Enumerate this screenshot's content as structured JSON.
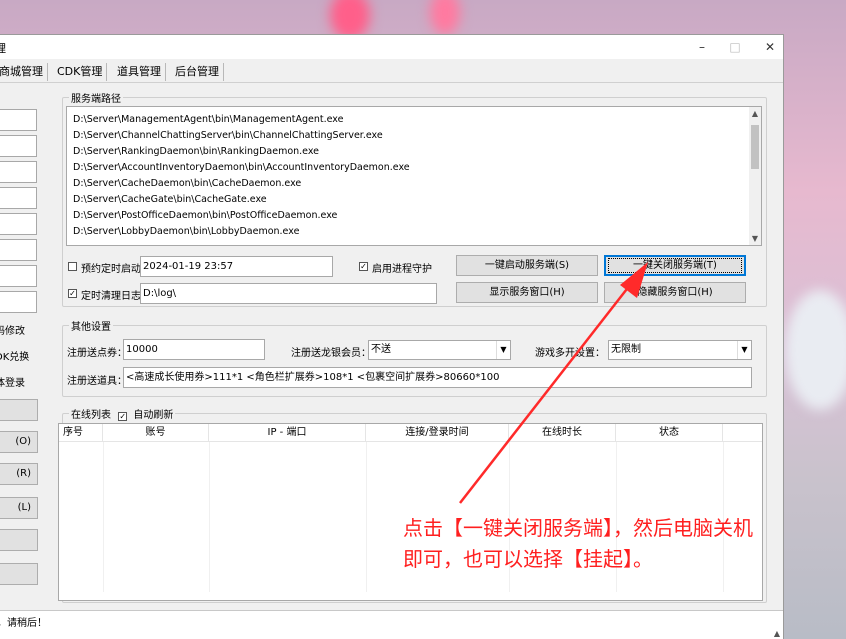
{
  "window": {
    "title": "理",
    "minimize": "–",
    "maximize": "□",
    "close": "✕"
  },
  "tabs": [
    "商城管理",
    "CDK管理",
    "道具管理",
    "后台管理"
  ],
  "left_panel": {
    "labels": [
      "码修改",
      "DK兑换",
      "体登录"
    ],
    "buttons": [
      "",
      "(O)",
      "(R)",
      "(L)",
      "",
      ""
    ]
  },
  "service_paths": {
    "title": "服务端路径",
    "items": [
      "D:\\Server\\ManagementAgent\\bin\\ManagementAgent.exe",
      "D:\\Server\\ChannelChattingServer\\bin\\ChannelChattingServer.exe",
      "D:\\Server\\RankingDaemon\\bin\\RankingDaemon.exe",
      "D:\\Server\\AccountInventoryDaemon\\bin\\AccountInventoryDaemon.exe",
      "D:\\Server\\CacheDaemon\\bin\\CacheDaemon.exe",
      "D:\\Server\\CacheGate\\bin\\CacheGate.exe",
      "D:\\Server\\PostOfficeDaemon\\bin\\PostOfficeDaemon.exe",
      "D:\\Server\\LobbyDaemon\\bin\\LobbyDaemon.exe"
    ]
  },
  "controls": {
    "schedule_start_label": "预约定时启动",
    "schedule_start_value": "2024-01-19 23:57",
    "schedule_start_checked": "",
    "daemon_label": "启用进程守护",
    "daemon_checked": "✓",
    "clean_log_label": "定时清理日志",
    "clean_log_value": "D:\\log\\",
    "clean_log_checked": "✓",
    "start_all": "一键启动服务端(S)",
    "stop_all": "一键关闭服务端(T)",
    "show_window": "显示服务窗口(H)",
    "hide_window": "隐藏服务窗口(H)"
  },
  "other_settings": {
    "title": "其他设置",
    "points_label": "注册送点券：",
    "points_value": "10000",
    "member_label": "注册送龙银会员：",
    "member_value": "不送",
    "multi_label": "游戏多开设置：",
    "multi_value": "无限制",
    "items_label": "注册送道具：",
    "items_value": "<高速成长使用券>111*1 <角色栏扩展券>108*1 <包裹空间扩展券>80660*100"
  },
  "online_list": {
    "title": "在线列表",
    "auto_refresh_label": "自动刷新",
    "auto_refresh_checked": "✓",
    "columns": [
      "序号",
      "账号",
      "IP - 端口",
      "连接/登录时间",
      "在线时长",
      "状态"
    ]
  },
  "status": {
    "text": "，请稍后！"
  },
  "annotation": {
    "line1": "点击【一键关闭服务端】，然后电脑关机",
    "line2": "即可，也可以选择【挂起】。",
    "color": "#ff1f1f"
  }
}
